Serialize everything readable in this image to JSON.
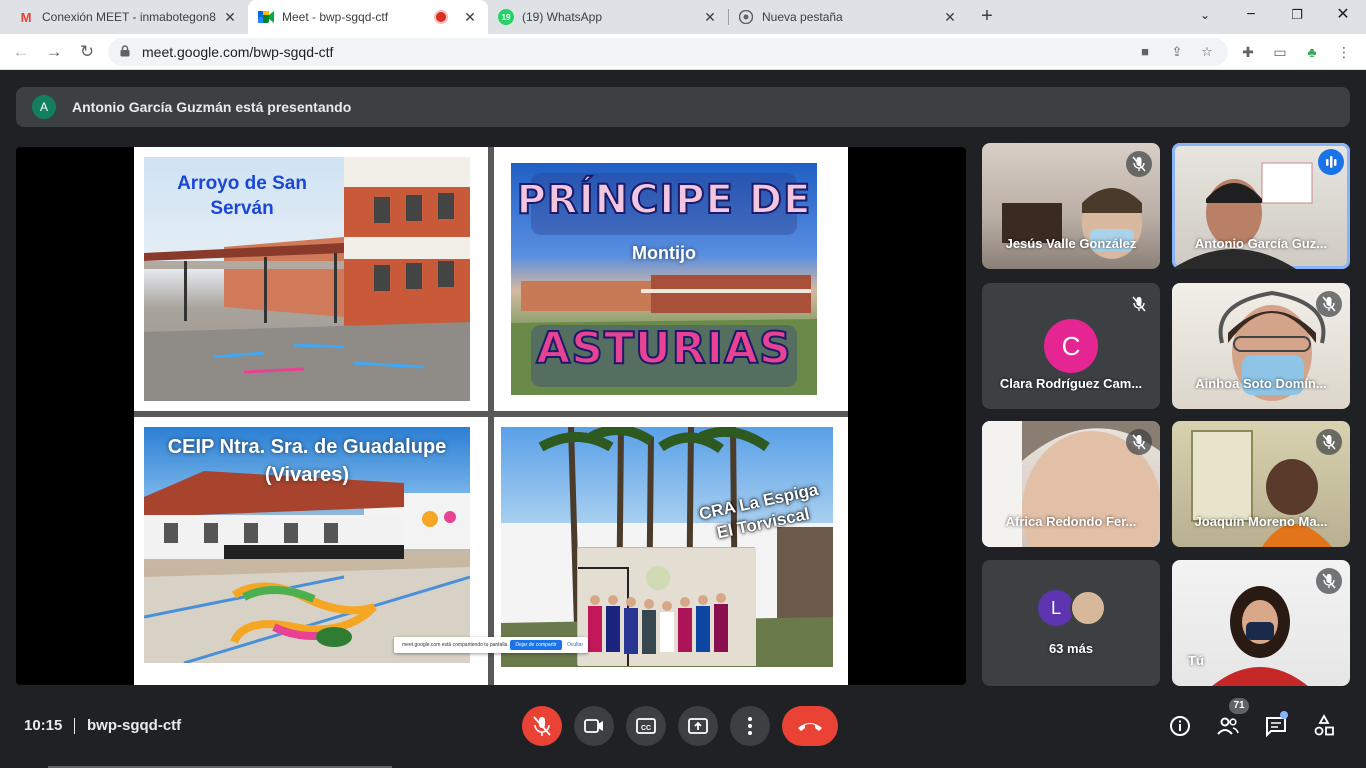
{
  "browser": {
    "tabs": [
      {
        "title": "Conexión MEET - inmabotegon8@",
        "favicon": "gmail-icon"
      },
      {
        "title": "Meet - bwp-sgqd-ctf",
        "favicon": "meet-icon",
        "recording": true
      },
      {
        "title": "(19) WhatsApp",
        "favicon": "whatsapp-icon",
        "badge": "19"
      },
      {
        "title": "Nueva pestaña",
        "favicon": "chrome-icon"
      }
    ],
    "url": "meet.google.com/bwp-sgqd-ctf"
  },
  "meet": {
    "presenting": {
      "avatar_letter": "A",
      "text": "Antonio García Guzmán está presentando"
    },
    "slide": {
      "q1": {
        "label": "Arroyo de San\nServán"
      },
      "q2": {
        "label_top": "PRÍNCIPE DE",
        "label_mid": "Montijo",
        "label_bottom": "ASTURIAS"
      },
      "q3": {
        "label": "CEIP Ntra. Sra. de Guadalupe\n(Vivares)"
      },
      "q4": {
        "label": "CRA La Espiga\nEl Torviscal"
      }
    },
    "share_toast": {
      "text": "meet.google.com está compartiendo tu pantalla.",
      "stop_label": "Dejar de compartir",
      "hide_label": "Ocultar"
    },
    "participants": [
      {
        "name": "Jesús Valle González",
        "muted": true
      },
      {
        "name": "Antonio García Guz...",
        "speaking": true
      },
      {
        "name": "Clara Rodríguez Cam...",
        "avatar_letter": "C",
        "avatar_color": "#e52592",
        "muted": true
      },
      {
        "name": "Ainhoa Soto Domín...",
        "muted": true
      },
      {
        "name": "África Redondo Fer...",
        "muted": true
      },
      {
        "name": "Joaquín Moreno Ma...",
        "muted": true
      },
      {
        "name": "63 más",
        "avatar_letter": "L",
        "avatar_color": "#5e35b1"
      },
      {
        "name": "Tú",
        "muted": true
      }
    ],
    "footer": {
      "time": "10:15",
      "code": "bwp-sgqd-ctf",
      "participant_count": "71"
    }
  }
}
